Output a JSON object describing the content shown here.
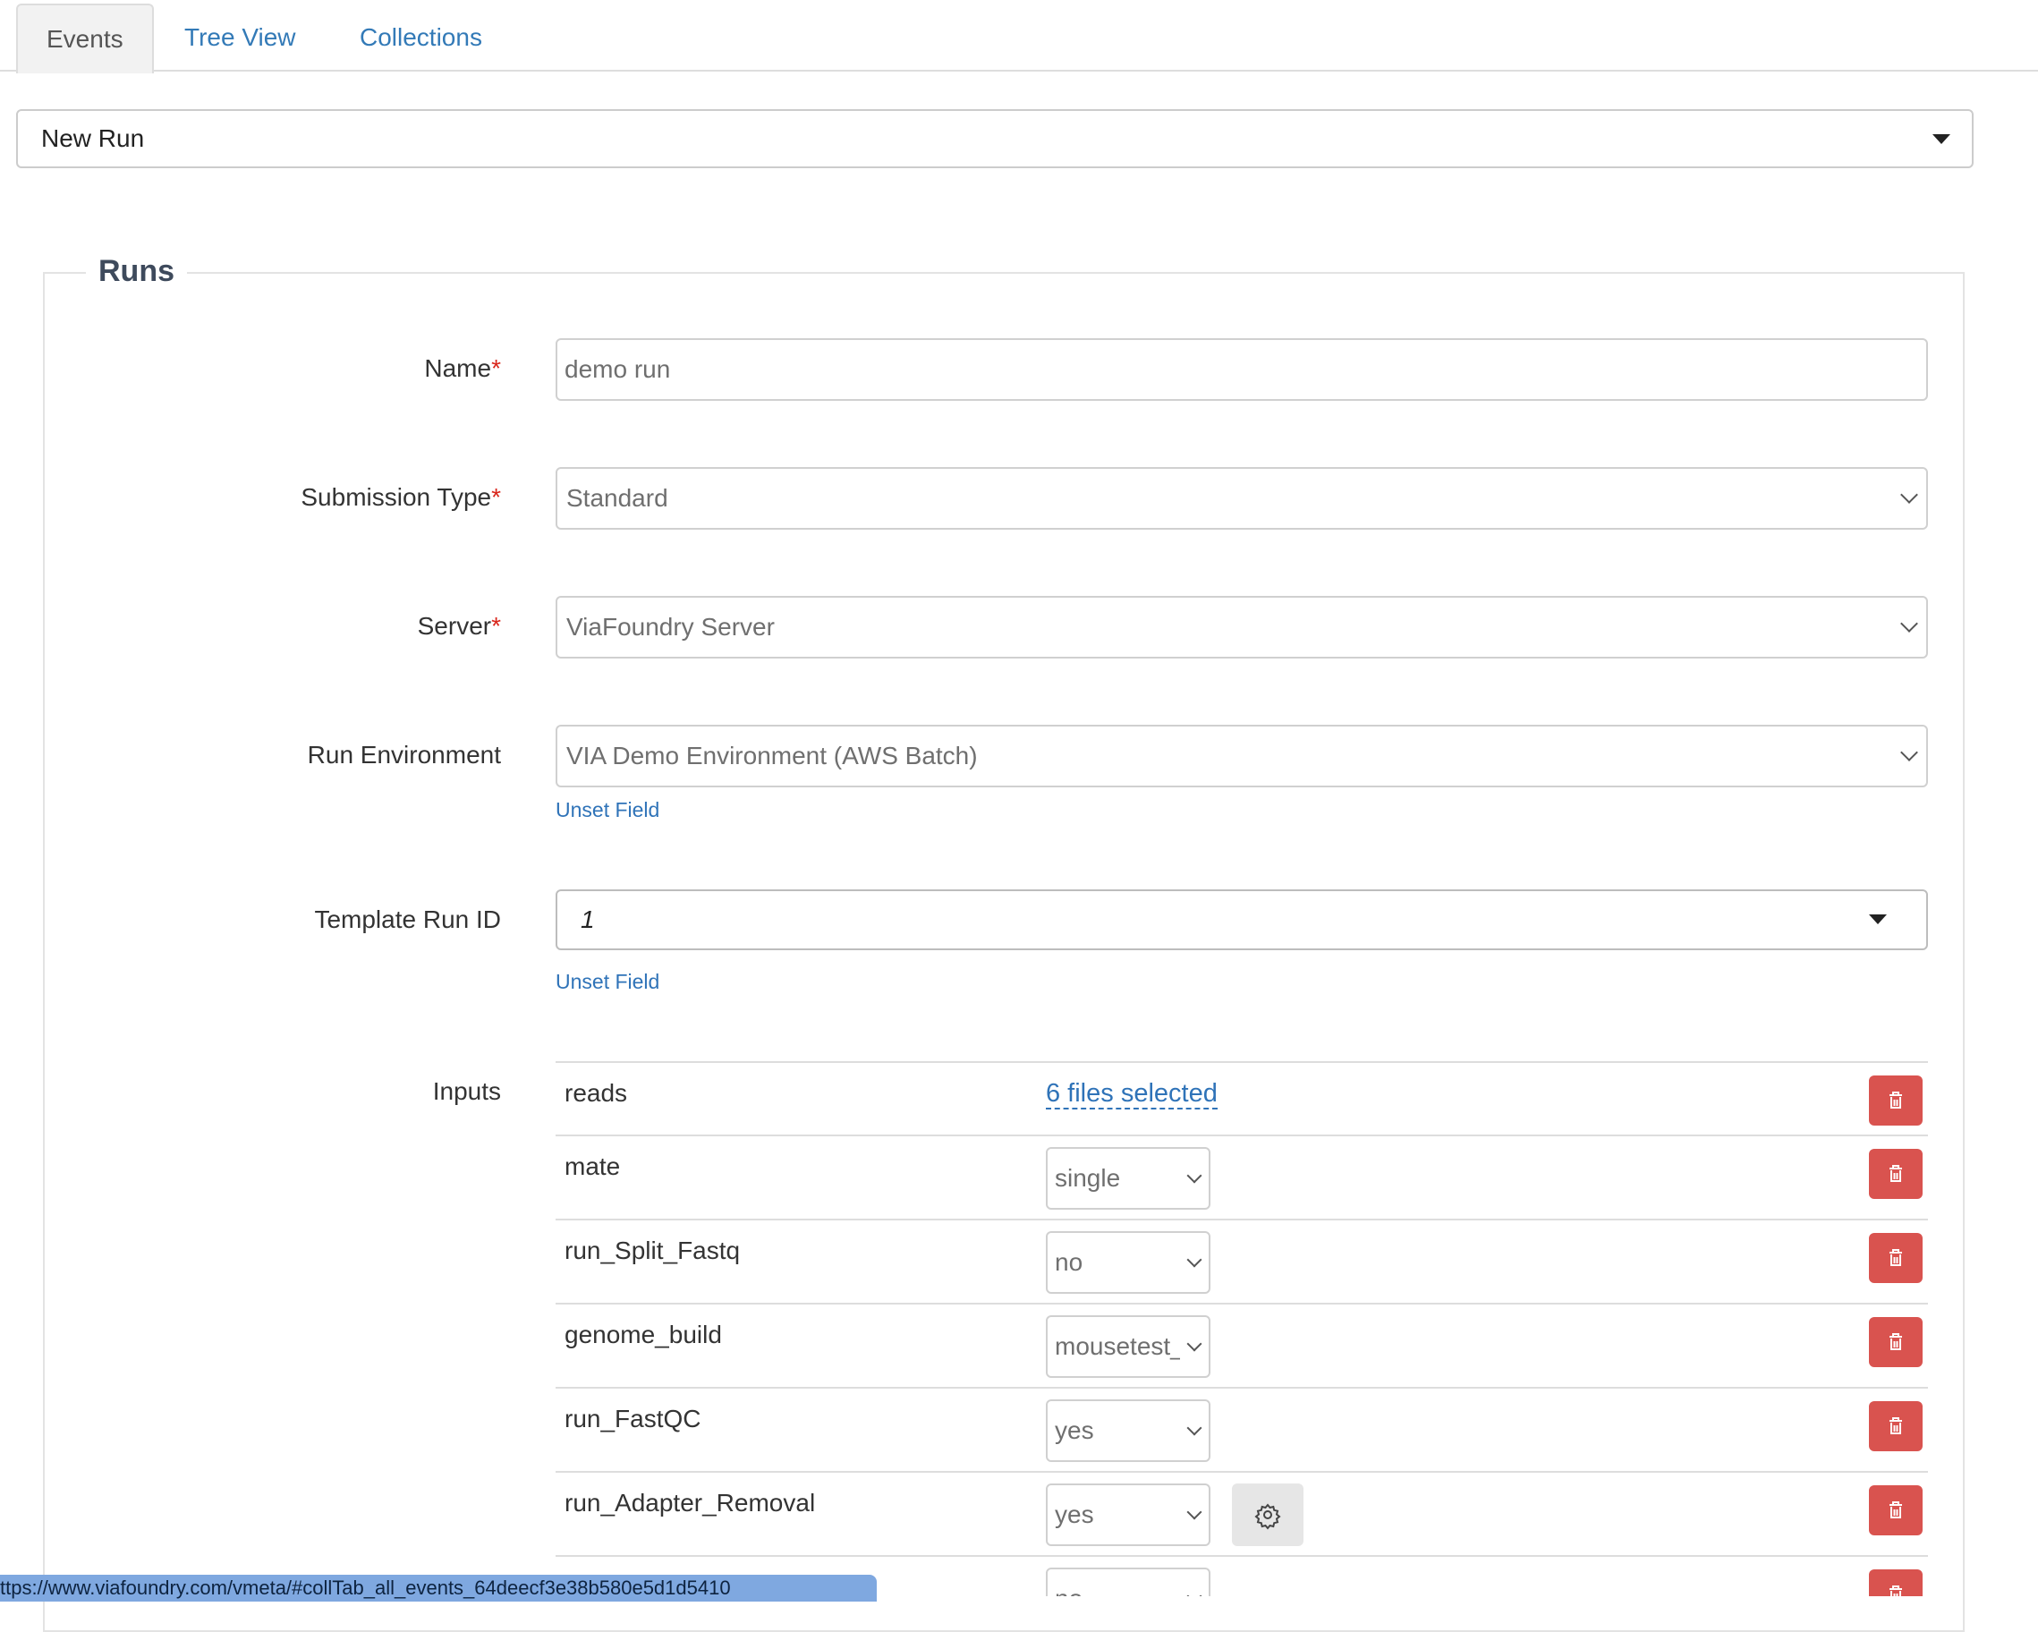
{
  "tabs": [
    {
      "label": "Events",
      "active": true
    },
    {
      "label": "Tree View",
      "active": false
    },
    {
      "label": "Collections",
      "active": false
    }
  ],
  "event_select": {
    "value": "New Run"
  },
  "legend": "Runs",
  "required_marker": "*",
  "form": {
    "name": {
      "label": "Name",
      "value": "demo run"
    },
    "submission_type": {
      "label": "Submission Type",
      "value": "Standard"
    },
    "server": {
      "label": "Server",
      "value": "ViaFoundry Server"
    },
    "run_environment": {
      "label": "Run Environment",
      "value": "VIA Demo Environment (AWS Batch)",
      "unset_label": "Unset Field"
    },
    "template_run_id": {
      "label": "Template Run ID",
      "value": "1",
      "unset_label": "Unset Field"
    },
    "inputs_label": "Inputs"
  },
  "inputs": [
    {
      "name": "reads",
      "files_link": "6 files selected"
    },
    {
      "name": "mate",
      "value": "single"
    },
    {
      "name": "run_Split_Fastq",
      "value": "no"
    },
    {
      "name": "genome_build",
      "value": "mousetest_"
    },
    {
      "name": "run_FastQC",
      "value": "yes"
    },
    {
      "name": "run_Adapter_Removal",
      "value": "yes"
    },
    {
      "name": "",
      "value": "no"
    }
  ],
  "icons": {
    "delete": "trash-icon",
    "settings": "gear-icon",
    "dropdown": "chevron-down-icon"
  },
  "colors": {
    "link": "#2f73b8",
    "danger": "#d9534f",
    "required": "#d9261c"
  },
  "status_url": "ttps://www.viafoundry.com/vmeta/#collTab_all_events_64deecf3e38b580e5d1d5410"
}
